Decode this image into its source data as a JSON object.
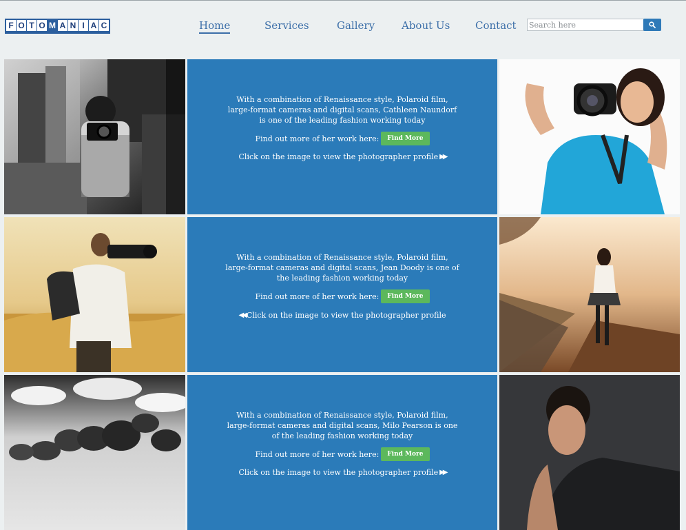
{
  "logo": {
    "letters": [
      "F",
      "O",
      "T",
      "O",
      "M",
      "A",
      "N",
      "I",
      "A",
      "C"
    ]
  },
  "nav": {
    "items": [
      {
        "label": "Home"
      },
      {
        "label": "Services"
      },
      {
        "label": "Gallery"
      },
      {
        "label": "About Us"
      },
      {
        "label": "Contact"
      }
    ]
  },
  "search": {
    "placeholder": "Search here",
    "button_icon": "search-icon"
  },
  "profiles": [
    {
      "description": "With a combination of Renaissance style, Polaroid film, large-format cameras and digital scans, Cathleen Naundorf is one of the leading fashion working today",
      "find_label": "Find out more of her work here:",
      "button_label": "Find More",
      "click_text": "Click on the image to view the photographer profile",
      "arrow_direction": "right"
    },
    {
      "description": "With a combination of Renaissance style, Polaroid film, large-format cameras and digital scans, Jean Doody is one of the leading fashion working today",
      "find_label": "Find out more of her work here:",
      "button_label": "Find More",
      "click_text": "Click on the image to view the photographer profile",
      "arrow_direction": "left"
    },
    {
      "description": "With a combination of Renaissance style, Polaroid film, large-format cameras and digital scans, Milo Pearson is one of the leading fashion working today",
      "find_label": "Find out more of her work here:",
      "button_label": "Find More",
      "click_text": "Click on the image to view the photographer profile",
      "arrow_direction": "right"
    }
  ],
  "colors": {
    "background": "#ecf0f1",
    "nav_text": "#3b6ea8",
    "tile_blue": "#2b7bb9",
    "button_green": "#5cb85c",
    "search_button": "#2f7ab8"
  }
}
